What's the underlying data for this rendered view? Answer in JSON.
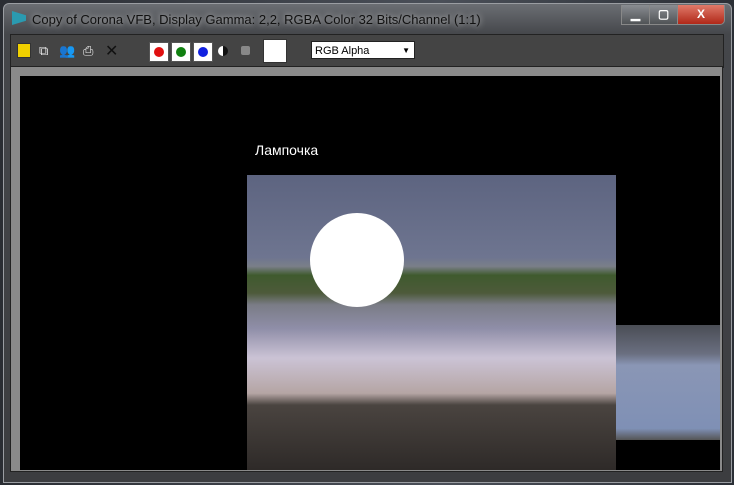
{
  "window": {
    "title": "Copy of Corona VFB, Display Gamma: 2,2, RGBA Color 32 Bits/Channel (1:1)"
  },
  "controls": {
    "minimize": "▁",
    "maximize": "▢",
    "close": "X"
  },
  "toolbar": {
    "icons": [
      "save-icon",
      "copy-icon",
      "clone-icon",
      "print-icon",
      "clear-icon"
    ],
    "channels": {
      "red": "#e01010",
      "green": "#108010",
      "blue": "#1020e0"
    },
    "channel_select": "RGB Alpha"
  },
  "render": {
    "label": "Лампочка"
  }
}
